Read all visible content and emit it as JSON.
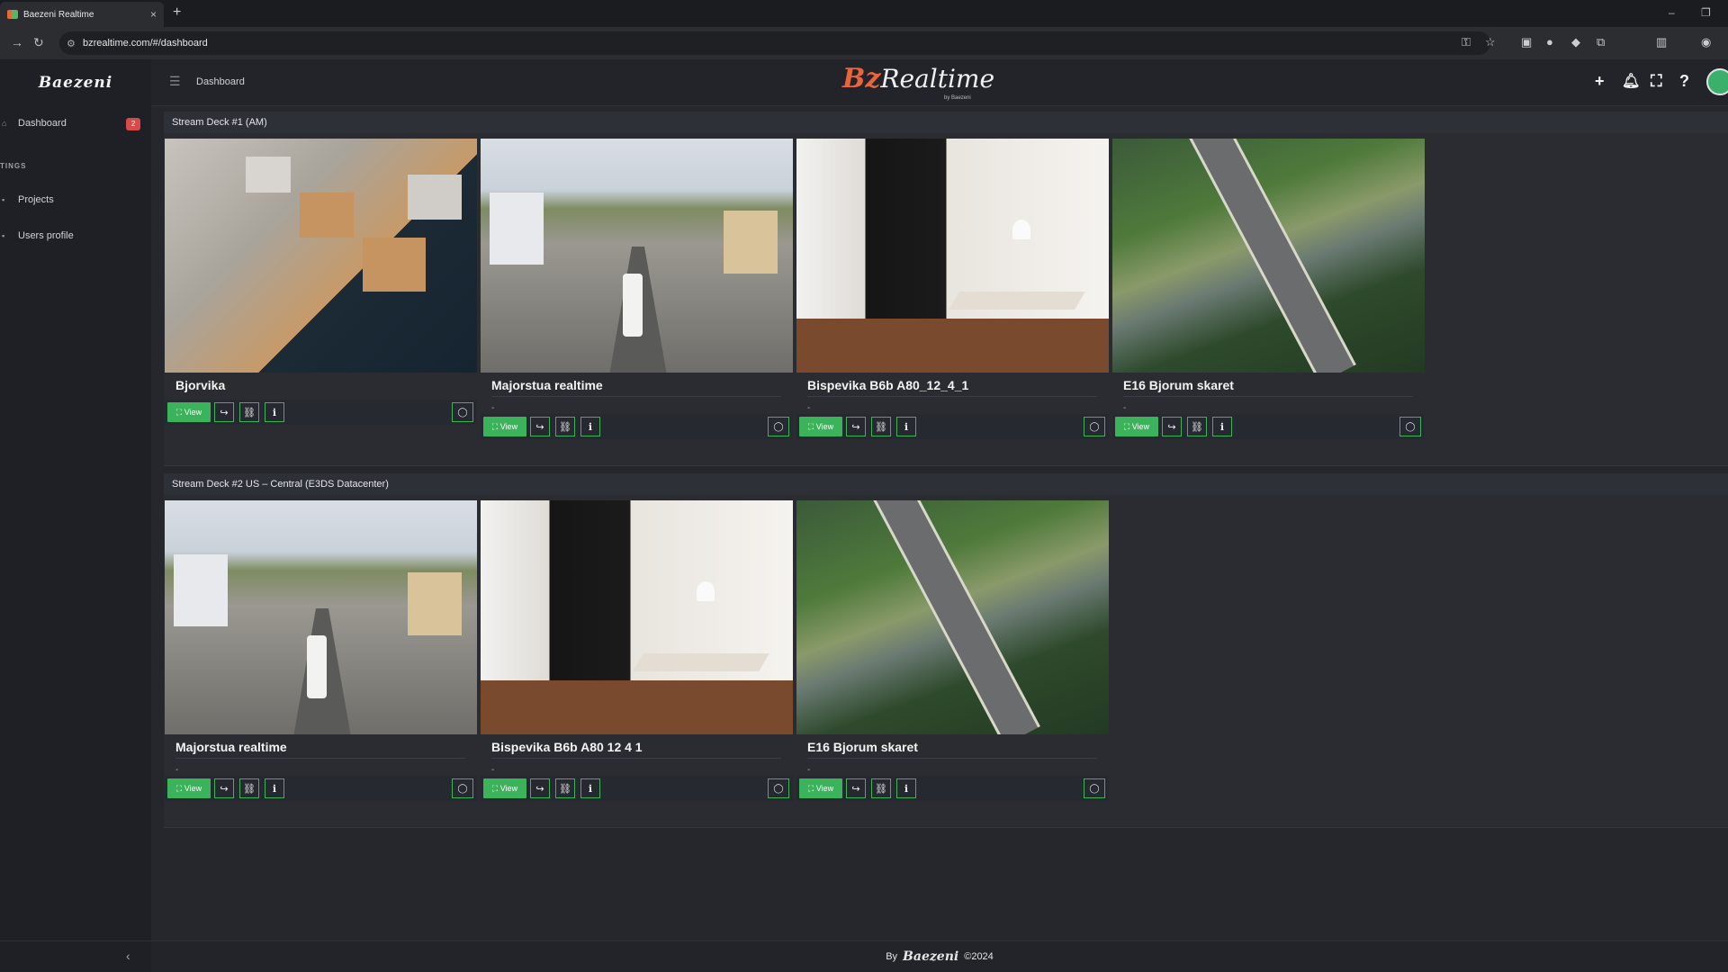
{
  "browser": {
    "tab_title": "Baezeni Realtime",
    "tab_close": "×",
    "new_tab": "+",
    "url": "bzrealtime.com/#/dashboard",
    "window_controls": [
      "–",
      "❐"
    ]
  },
  "header": {
    "brand": "Baezeni",
    "breadcrumb": "Dashboard",
    "logo_bz": "Bz",
    "logo_realtime": "Realtime",
    "logo_by": "by Baezeni",
    "icons": [
      "plus-icon",
      "bell-icon",
      "fullscreen-icon",
      "help-icon",
      "avatar"
    ]
  },
  "sidebar": {
    "items": [
      {
        "label": "Dashboard",
        "badge": "2"
      },
      {
        "label": "Projects"
      },
      {
        "label": "Users profile"
      }
    ],
    "section_label": "TINGS"
  },
  "decks": [
    {
      "title": "Stream Deck #1 (AM)",
      "cards": [
        {
          "name": "Bjorvika",
          "subtitle": ""
        },
        {
          "name": "Majorstua realtime",
          "subtitle": "-"
        },
        {
          "name": "Bispevika B6b A80_12_4_1",
          "subtitle": "-"
        },
        {
          "name": "E16 Bjorum skaret",
          "subtitle": "-"
        }
      ]
    },
    {
      "title": "Stream Deck #2 US – Central (E3DS Datacenter)",
      "cards": [
        {
          "name": "Majorstua realtime",
          "subtitle": "-"
        },
        {
          "name": "Bispevika B6b A80 12 4 1",
          "subtitle": "-"
        },
        {
          "name": "E16 Bjorum skaret",
          "subtitle": "-"
        }
      ]
    }
  ],
  "actions": {
    "view_label": "View"
  },
  "footer": {
    "by": "By",
    "brand": "Baezeni",
    "year": "©2024"
  },
  "colors": {
    "accent_green": "#3ab35a",
    "logo_orange": "#e8643c",
    "badge_red": "#d84a4a"
  }
}
